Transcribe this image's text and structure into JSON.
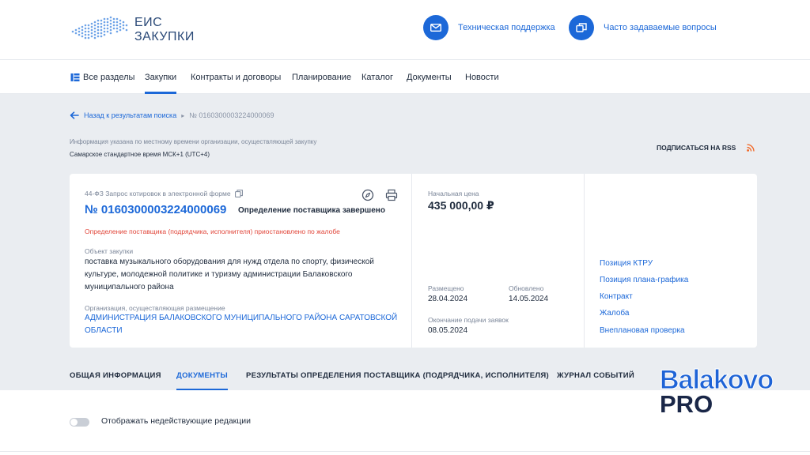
{
  "header": {
    "logo_line1": "ЕИС",
    "logo_line2": "ЗАКУПКИ",
    "support_label": "Техническая поддержка",
    "faq_label": "Часто задаваемые вопросы"
  },
  "nav": {
    "items": [
      {
        "label": "Все разделы"
      },
      {
        "label": "Закупки",
        "active": true
      },
      {
        "label": "Контракты и договоры"
      },
      {
        "label": "Планирование"
      },
      {
        "label": "Каталог"
      },
      {
        "label": "Документы"
      },
      {
        "label": "Новости"
      }
    ]
  },
  "breadcrumb": {
    "back_label": "Назад к результатам поиска",
    "separator": "▸",
    "current": "№ 0160300003224000069"
  },
  "timezone": {
    "note": "Информация указана по местному времени организации, осуществляющей закупку",
    "value": "Самарское стандартное время МСК+1 (UTC+4)"
  },
  "rss": {
    "label": "ПОДПИСАТЬСЯ НА RSS"
  },
  "purchase": {
    "law_type": "44-ФЗ Запрос котировок в электронной форме",
    "number": "№ 0160300003224000069",
    "status": "Определение поставщика завершено",
    "warning": "Определение поставщика (подрядчика, исполнителя) приостановлено по жалобе",
    "object_label": "Объект закупки",
    "object_value": "поставка музыкального оборудования для нужд отдела по спорту, физической культуре, молодежной политике и туризму администрации Балаковского муниципального района",
    "org_label": "Организация, осуществляющая размещение",
    "org_value": "АДМИНИСТРАЦИЯ БАЛАКОВСКОГО МУНИЦИПАЛЬНОГО РАЙОНА САРАТОВСКОЙ ОБЛАСТИ"
  },
  "price": {
    "label": "Начальная цена",
    "value": "435 000,00 ₽"
  },
  "dates": {
    "posted_label": "Размещено",
    "posted_value": "28.04.2024",
    "updated_label": "Обновлено",
    "updated_value": "14.05.2024",
    "deadline_label": "Окончание подачи заявок",
    "deadline_value": "08.05.2024"
  },
  "side_links": [
    {
      "label": "Позиция КТРУ"
    },
    {
      "label": "Позиция плана-графика"
    },
    {
      "label": "Контракт"
    },
    {
      "label": "Жалоба"
    },
    {
      "label": "Внеплановая проверка"
    }
  ],
  "tabs": [
    {
      "label": "ОБЩАЯ ИНФОРМАЦИЯ"
    },
    {
      "label": "ДОКУМЕНТЫ",
      "active": true
    },
    {
      "label": "РЕЗУЛЬТАТЫ ОПРЕДЕЛЕНИЯ ПОСТАВЩИКА (ПОДРЯДЧИКА, ИСПОЛНИТЕЛЯ)"
    },
    {
      "label": "ЖУРНАЛ СОБЫТИЙ"
    }
  ],
  "toggle": {
    "label": "Отображать недействующие редакции",
    "on": false
  },
  "watermark": {
    "line1": "Balakovo",
    "line2": "PRO"
  },
  "colors": {
    "accent": "#1c68d8",
    "warning": "#e1463a",
    "background_grey": "#eaedf1",
    "rss": "#f26522"
  }
}
